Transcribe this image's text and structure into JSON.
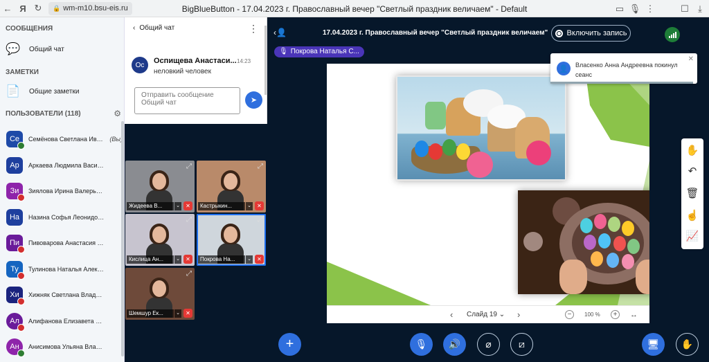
{
  "browser": {
    "url": "wm-m10.bsu-eis.ru",
    "title": "BigBlueButton - 17.04.2023 г. Православный вечер \"Светлый праздник величаем\" - Default"
  },
  "sidebar": {
    "messages_heading": "СООБЩЕНИЯ",
    "public_chat": "Общий чат",
    "notes_heading": "ЗАМЕТКИ",
    "shared_notes": "Общие заметки",
    "users_heading": "ПОЛЬЗОВАТЕЛИ (118)",
    "users": [
      {
        "initials": "Се",
        "name": "Семёнова Светлана Иван...",
        "you": "(Вы)",
        "color": "#1e4aa8",
        "status": "green",
        "square": true
      },
      {
        "initials": "Ар",
        "name": "Аркаева Людмила Васильевна",
        "color": "#1e3f9e",
        "status": "none",
        "square": true
      },
      {
        "initials": "Зи",
        "name": "Зиялова Ирина Валерьевна",
        "color": "#8e24aa",
        "status": "red",
        "square": true
      },
      {
        "initials": "На",
        "name": "Назина Софья Леонидовна",
        "color": "#1e3f9e",
        "status": "none",
        "square": true
      },
      {
        "initials": "Пи",
        "name": "Пивоварова Анастасия Сергее...",
        "color": "#6a1b9a",
        "status": "red",
        "square": true
      },
      {
        "initials": "Ту",
        "name": "Тулинова Наталья Александров...",
        "color": "#1565c0",
        "status": "red",
        "square": true
      },
      {
        "initials": "Хи",
        "name": "Хижняк Светлана Владимиров...",
        "color": "#1a237e",
        "status": "red",
        "square": true
      },
      {
        "initials": "Ал",
        "name": "Алифанова Елизавета Сергее...",
        "color": "#6a1b9a",
        "status": "red",
        "square": false
      },
      {
        "initials": "Ан",
        "name": "Анисимова Ульяна Владимиров...",
        "color": "#8e24aa",
        "status": "green",
        "square": false
      }
    ]
  },
  "chat": {
    "title": "Общий чат",
    "message": {
      "initials": "Ос",
      "author": "Оспищева Анастаси...",
      "time": "14:23",
      "text": "неловкий человек"
    },
    "input_placeholder": "Отправить сообщение Общий чат"
  },
  "videos": [
    {
      "name": "Жидеева В...",
      "bg": "#8a8c91"
    },
    {
      "name": "Кастрыкин...",
      "bg": "#b98a6a"
    },
    {
      "name": "Кислица Ан...",
      "bg": "#c7c4cf"
    },
    {
      "name": "Покрова На...",
      "bg": "#cfd6dc"
    },
    {
      "name": "Шемшур Ек...",
      "bg": "#6e4a3a"
    }
  ],
  "meeting": {
    "title": "17.04.2023 г. Православный вечер \"Светлый праздник величаем\"",
    "record_label": "Включить запись",
    "speaker": "Покрова Наталья С..."
  },
  "toast": {
    "text": "Власенко Анна Андреевна покинул сеанс",
    "progress": 0.97
  },
  "presentation": {
    "slide_label": "Слайд 19",
    "zoom": "100 %"
  },
  "colors": {
    "accent": "#2f6fde",
    "dark_bg": "#06172a",
    "mute": "#e53935",
    "green": "#1e7d38"
  }
}
